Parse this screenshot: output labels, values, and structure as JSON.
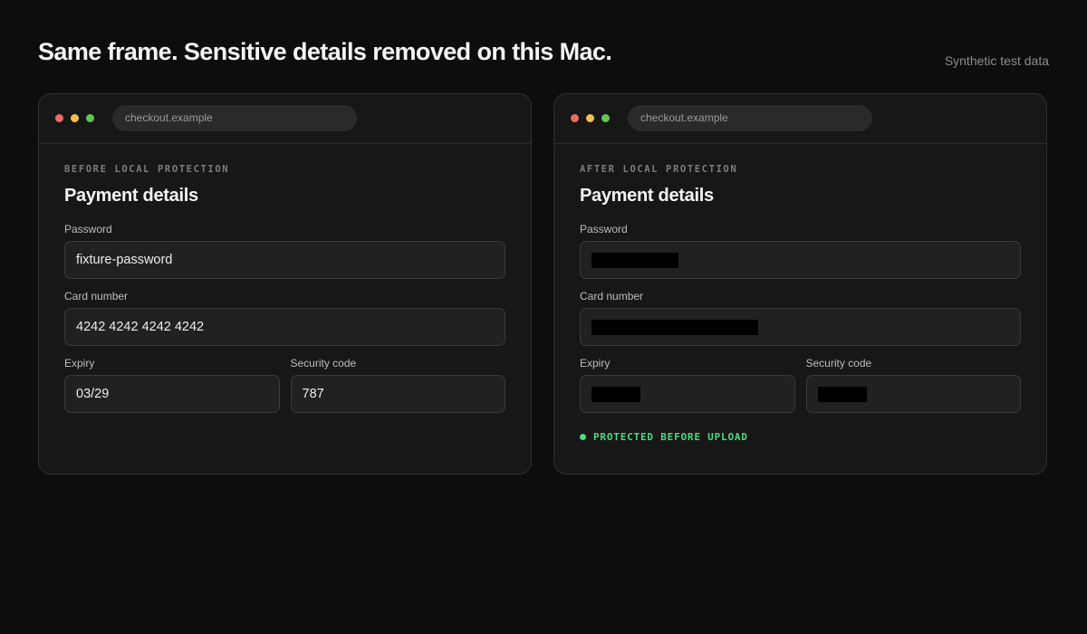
{
  "header": {
    "headline": "Same frame. Sensitive details removed on this Mac.",
    "tagline": "Synthetic test data"
  },
  "colors": {
    "background": "#0d0d0d",
    "window": "#171717",
    "success": "#4ddb7a",
    "redaction": "#000000"
  },
  "before": {
    "url": "checkout.example",
    "eyebrow": "BEFORE LOCAL PROTECTION",
    "heading": "Payment details",
    "password_label": "Password",
    "password_value": "fixture-password",
    "card_label": "Card number",
    "card_value": "4242 4242 4242 4242",
    "expiry_label": "Expiry",
    "expiry_value": "03/29",
    "cvc_label": "Security code",
    "cvc_value": "787"
  },
  "after": {
    "url": "checkout.example",
    "eyebrow": "AFTER LOCAL PROTECTION",
    "heading": "Payment details",
    "password_label": "Password",
    "card_label": "Card number",
    "expiry_label": "Expiry",
    "cvc_label": "Security code",
    "status": "PROTECTED BEFORE UPLOAD"
  },
  "icons": {
    "close": "close-dot-icon",
    "minimize": "minimize-dot-icon",
    "zoom": "zoom-dot-icon",
    "status": "status-dot-icon"
  }
}
